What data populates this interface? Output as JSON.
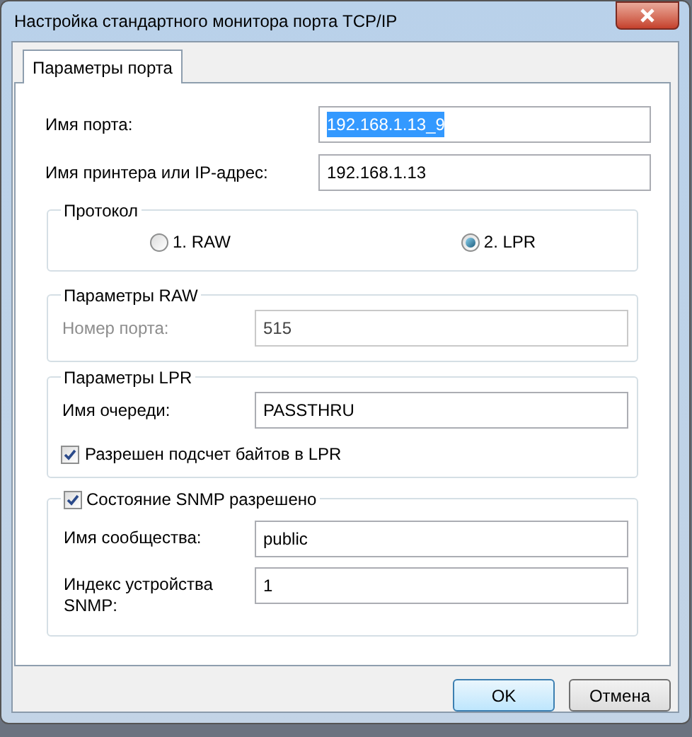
{
  "window": {
    "title": "Настройка стандартного монитора порта TCP/IP"
  },
  "tabs": [
    {
      "label": "Параметры порта",
      "selected": true
    }
  ],
  "port_name": {
    "label": "Имя порта:",
    "value": "192.168.1.13_9",
    "text_selected": true
  },
  "printer_address": {
    "label": "Имя принтера или IP-адрес:",
    "value": "192.168.1.13"
  },
  "protocol": {
    "title": "Протокол",
    "options": [
      {
        "label": "1. RAW",
        "selected": false
      },
      {
        "label": "2. LPR",
        "selected": true
      }
    ]
  },
  "raw_settings": {
    "title": "Параметры RAW",
    "disabled": true,
    "port_number": {
      "label": "Номер порта:",
      "value": "515"
    }
  },
  "lpr_settings": {
    "title": "Параметры LPR",
    "queue": {
      "label": "Имя очереди:",
      "value": "PASSTHRU"
    },
    "byte_counting": {
      "label": "Разрешен подсчет байтов в LPR",
      "checked": true
    }
  },
  "snmp": {
    "label": "Состояние SNMP разрешено",
    "checked": true,
    "fields": [
      {
        "label": "Имя сообщества:",
        "value": "public"
      },
      {
        "label": "Индекс устройства SNMP:",
        "value": "1"
      }
    ]
  },
  "buttons": [
    {
      "label": "OK",
      "default": true
    },
    {
      "label": "Отмена",
      "default": false
    }
  ]
}
